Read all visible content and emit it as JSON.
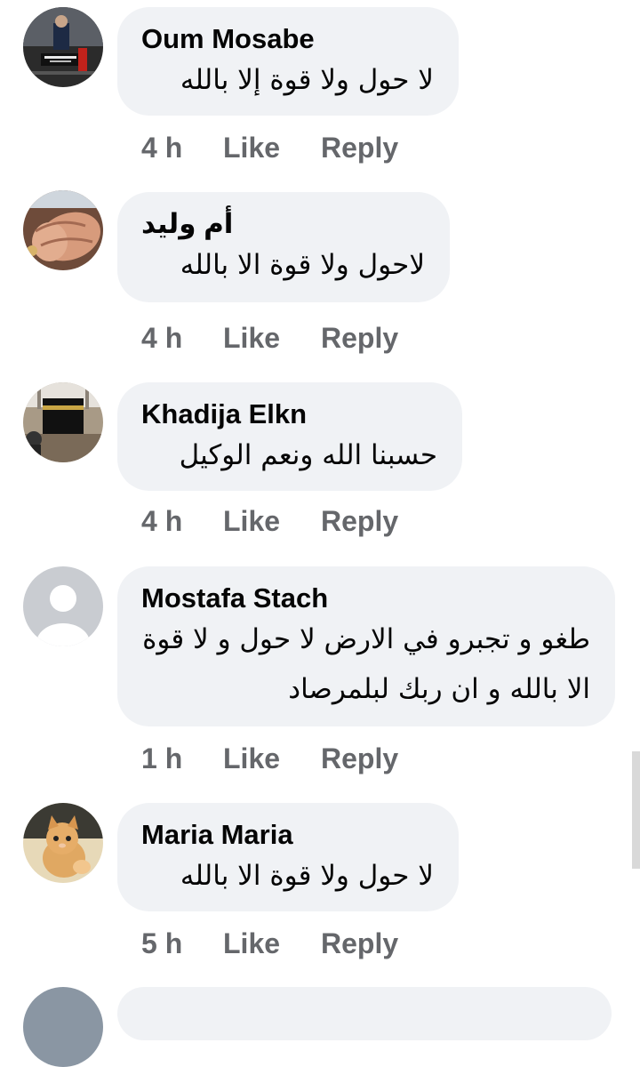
{
  "comments": [
    {
      "author": "Oum Mosabe",
      "text": "لا حول ولا قوة إلا بالله",
      "time": "4 h",
      "like_label": "Like",
      "reply_label": "Reply",
      "avatar": "religious-poster-avatar"
    },
    {
      "author": "أم وليد",
      "text": "لاحول ولا قوة الا بالله",
      "time": "4 h",
      "like_label": "Like",
      "reply_label": "Reply",
      "avatar": "praying-hands-avatar"
    },
    {
      "author": "Khadija Elkn",
      "text": "حسبنا الله ونعم الوكيل",
      "time": "4 h",
      "like_label": "Like",
      "reply_label": "Reply",
      "avatar": "kaaba-avatar"
    },
    {
      "author": "Mostafa Stach",
      "text": "طغو و تجبرو في الارض لا حول و لا قوة الا بالله و ان ربك لبلمرصاد",
      "time": "1 h",
      "like_label": "Like",
      "reply_label": "Reply",
      "avatar": "default-user-avatar"
    },
    {
      "author": "Maria Maria",
      "text": "لا حول ولا قوة الا بالله",
      "time": "5 h",
      "like_label": "Like",
      "reply_label": "Reply",
      "avatar": "kitten-avatar"
    }
  ],
  "colors": {
    "bubble_background": "#f0f2f5",
    "author_text": "#050505",
    "action_text": "#65676b"
  }
}
